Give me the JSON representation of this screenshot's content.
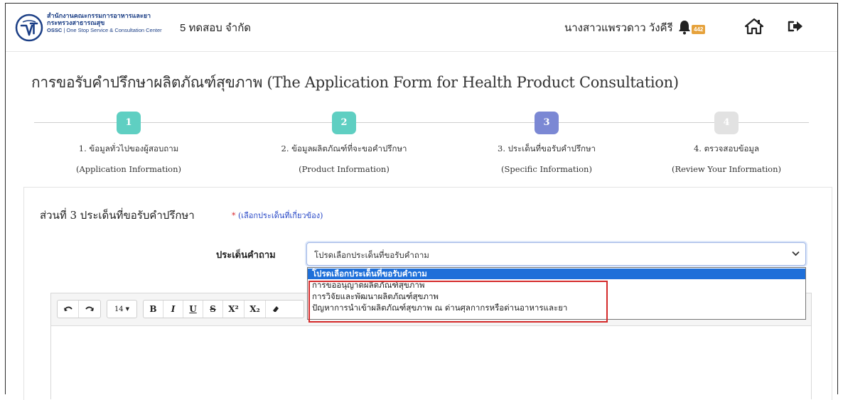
{
  "header": {
    "org_line1": "สำนักงานคณะกรรมการอาหารและยา",
    "org_line2": "กระทรวงสาธารณสุข",
    "org_line3_brand": "OSSC",
    "org_line3_rest": "| One Stop Service & Consultation Center",
    "company": "5 ทดสอบ จำกัด",
    "user_name": "นางสาวแพรวดาว วังคีรี",
    "notification_count": "442",
    "icons": {
      "logo": "fda-logo-icon",
      "bell": "bell-icon",
      "home": "home-icon",
      "logout": "logout-icon"
    }
  },
  "page": {
    "title": "การขอรับคำปรึกษาผลิตภัณฑ์สุขภาพ (The Application Form for Health Product Consultation)"
  },
  "steps": [
    {
      "number": "1",
      "label_th": "1. ข้อมูลทั่วไปของผู้สอบถาม",
      "label_en": "(Application Information)",
      "color": "#5fcfc2"
    },
    {
      "number": "2",
      "label_th": "2. ข้อมูลผลิตภัณฑ์ที่จะขอคำปรึกษา",
      "label_en": "(Product Information)",
      "color": "#5fcfc2"
    },
    {
      "number": "3",
      "label_th": "3. ประเด็นที่ขอรับคำปรึกษา",
      "label_en": "(Specific Information)",
      "color": "#7b88d4"
    },
    {
      "number": "4",
      "label_th": "4. ตรวจสอบข้อมูล",
      "label_en": "(Review Your Information)",
      "color": "#e2e2e2"
    }
  ],
  "section": {
    "title": "ส่วนที่ 3 ประเด็นที่ขอรับคำปรึกษา",
    "note_star": "*",
    "note": "(เลือกประเด็นที่เกี่ยวข้อง)"
  },
  "question_field": {
    "label": "ประเด็นคำถาม",
    "selected": "โปรดเลือกประเด็นที่ขอรับคำถาม",
    "options": [
      "โปรดเลือกประเด็นที่ขอรับคำถาม",
      "การขออนุญาตผลิตภัณฑ์สุขภาพ",
      "การวิจัยและพัฒนาผลิตภัณฑ์สุขภาพ",
      "ปัญหาการนำเข้าผลิตภัณฑ์สุขภาพ ณ ด่านศุลกากรหรือด่านอาหารและยา"
    ]
  },
  "editor": {
    "font_size": "14",
    "buttons": {
      "undo": "undo-icon",
      "redo": "redo-icon",
      "bold": "B",
      "italic": "I",
      "underline": "U",
      "strike": "S",
      "superscript": "X²",
      "subscript": "X₂",
      "eraser": "eraser-icon"
    }
  },
  "colors": {
    "accent_blue": "#1e6fd9",
    "highlight_red": "#d42a2a",
    "note_blue": "#2848c7",
    "badge": "#e6a23c"
  }
}
